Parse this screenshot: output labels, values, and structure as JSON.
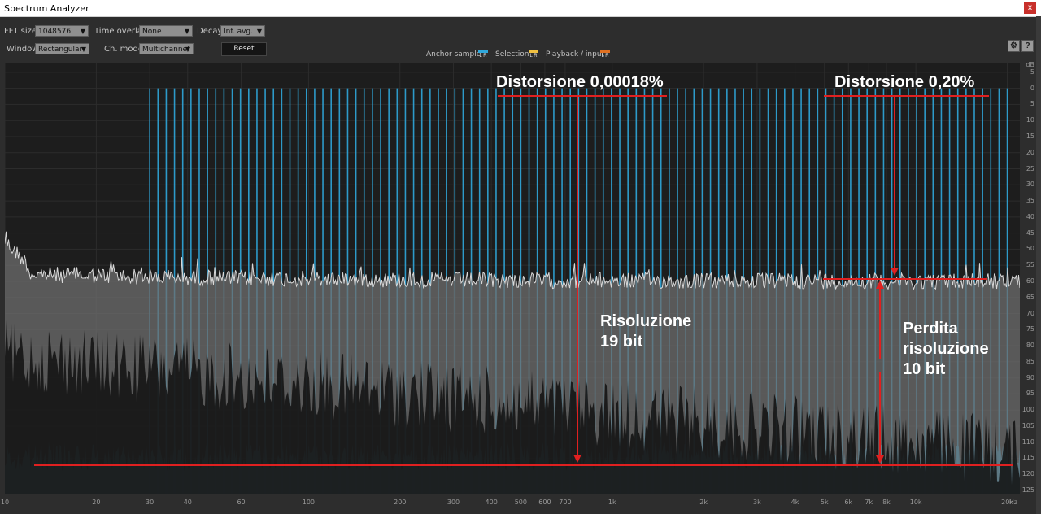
{
  "window": {
    "title": "Spectrum Analyzer",
    "close_label": "x"
  },
  "toolbar": {
    "fft_size_label": "FFT size",
    "fft_size_value": "1048576",
    "time_overlap_label": "Time overlap",
    "time_overlap_value": "None",
    "decay_label": "Decay",
    "decay_value": "Inf. avg.",
    "window_label": "Window",
    "window_value": "Rectangular",
    "ch_mode_label": "Ch. mode",
    "ch_mode_value": "Multichannel",
    "reset_label": "Reset",
    "anchor_label": "Anchor sample",
    "selection_label": "Selection",
    "playback_label": "Playback / input",
    "lr_label": "L R"
  },
  "colors": {
    "background": "#1d1d1d",
    "signal_cyan": "#2fa8dc",
    "noise_white": "#d8d8d8",
    "annotation_red": "#e02020"
  },
  "chart_data": {
    "type": "line",
    "x_scale": "log",
    "xlim": [
      10,
      22000
    ],
    "ylim": [
      -126,
      8
    ],
    "x_ticks": [
      10,
      20,
      30,
      40,
      60,
      100,
      200,
      300,
      400,
      500,
      600,
      700,
      1000,
      2000,
      3000,
      4000,
      5000,
      6000,
      7000,
      8000,
      10000,
      20000
    ],
    "x_tick_labels": [
      "10",
      "20",
      "30",
      "40",
      "60",
      "100",
      "200",
      "300",
      "400",
      "500",
      "600",
      "700",
      "1k",
      "2k",
      "3k",
      "4k",
      "5k",
      "6k",
      "7k",
      "8k",
      "10k",
      "20k"
    ],
    "x_unit": "Hz",
    "y_ticks": [
      5,
      0,
      -5,
      -10,
      -15,
      -20,
      -25,
      -30,
      -35,
      -40,
      -45,
      -50,
      -55,
      -60,
      -65,
      -70,
      -75,
      -80,
      -85,
      -90,
      -95,
      -100,
      -105,
      -110,
      -115,
      -120,
      -125
    ],
    "y_tick_labels": [
      "5",
      "0",
      "5",
      "10",
      "15",
      "20",
      "25",
      "30",
      "35",
      "40",
      "45",
      "50",
      "55",
      "60",
      "65",
      "70",
      "75",
      "80",
      "85",
      "90",
      "95",
      "100",
      "105",
      "110",
      "115",
      "120",
      "125"
    ],
    "y_unit": "dB",
    "series": [
      {
        "color": "#2fa8dc",
        "comb_start_hz": 30,
        "comb_end_hz": 20000,
        "comb_count": 105,
        "peak_db": 0,
        "floor_db": -116
      },
      {
        "color": "#d8d8d8",
        "level_low_db": -45,
        "level_high_db": -60
      }
    ],
    "annotations": {
      "dist_left": "Distorsione 0,00018%",
      "dist_right": "Distorsione 0,20%",
      "res_line1": "Risoluzione",
      "res_line2": "19 bit",
      "loss_line1": "Perdita",
      "loss_line2": "risoluzione",
      "loss_line3": "10 bit"
    }
  }
}
